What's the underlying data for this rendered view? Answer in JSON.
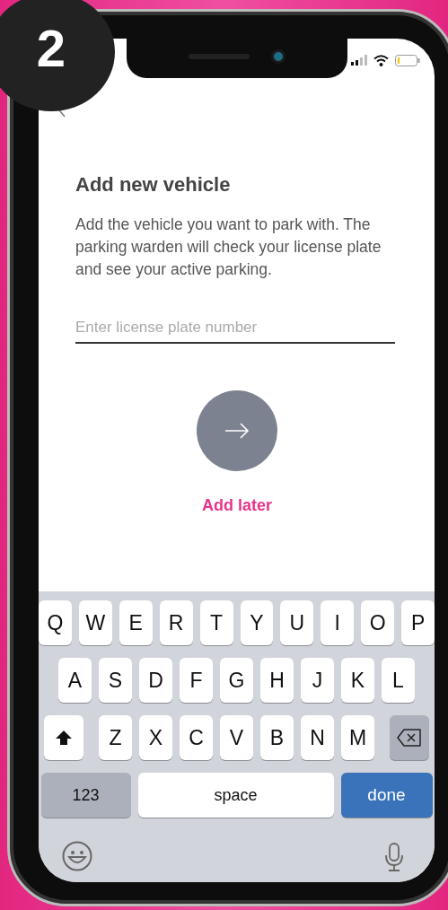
{
  "step_badge": "2",
  "screen": {
    "title": "Add new vehicle",
    "description": "Add the vehicle you want to park with. The parking warden will check your license plate and see your active parking.",
    "license_field": {
      "placeholder": "Enter license plate number"
    },
    "add_later": "Add later"
  },
  "keyboard": {
    "rows": [
      [
        "Q",
        "W",
        "E",
        "R",
        "T",
        "Y",
        "U",
        "I",
        "O",
        "P"
      ],
      [
        "A",
        "S",
        "D",
        "F",
        "G",
        "H",
        "J",
        "K",
        "L"
      ],
      [
        "Z",
        "X",
        "C",
        "V",
        "B",
        "N",
        "M"
      ]
    ],
    "numbers_key": "123",
    "space_key": "space",
    "done_key": "done"
  }
}
